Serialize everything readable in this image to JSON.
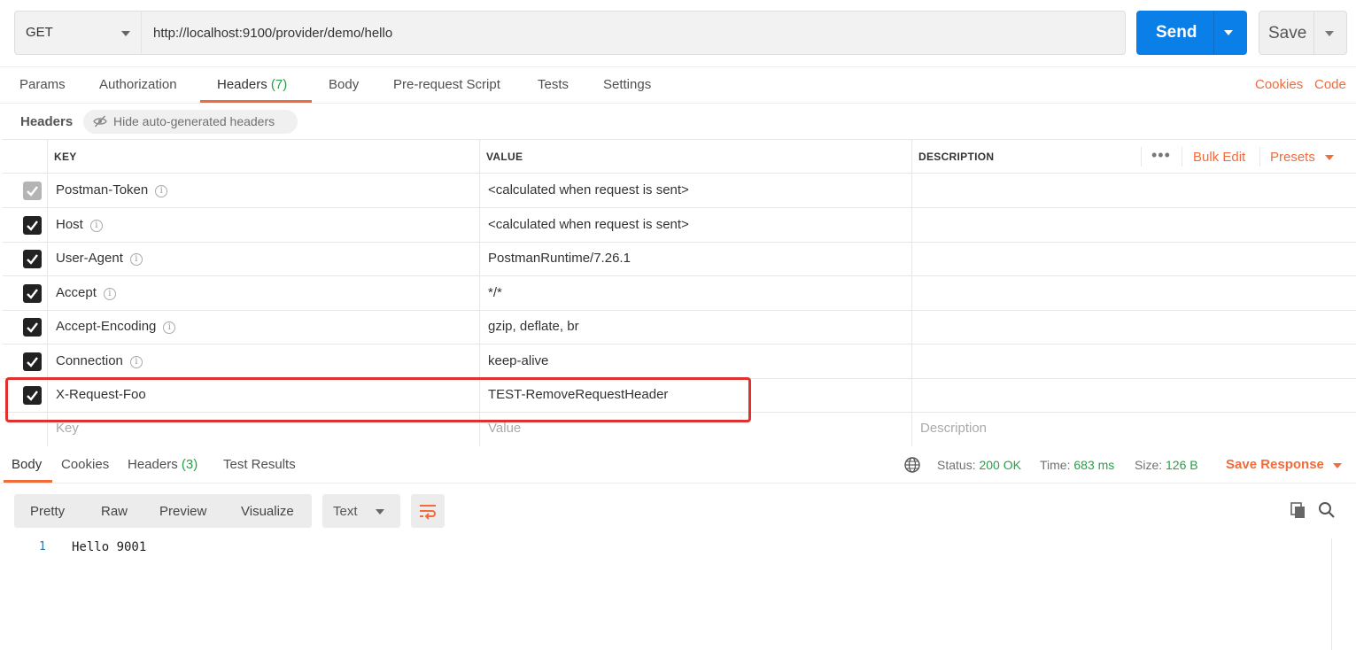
{
  "request": {
    "method": "GET",
    "url": "http://localhost:9100/provider/demo/hello",
    "send_label": "Send",
    "save_label": "Save"
  },
  "request_tabs": {
    "params": "Params",
    "authorization": "Authorization",
    "headers": "Headers",
    "headers_count": "(7)",
    "body": "Body",
    "pre_request": "Pre-request Script",
    "tests": "Tests",
    "settings": "Settings",
    "cookies": "Cookies",
    "code": "Code"
  },
  "headers_toolbar": {
    "title": "Headers",
    "hide_label": "Hide auto-generated headers"
  },
  "table": {
    "columns": {
      "key": "KEY",
      "value": "VALUE",
      "description": "DESCRIPTION"
    },
    "more": "•••",
    "bulk_edit": "Bulk Edit",
    "presets": "Presets",
    "rows": [
      {
        "key": "Postman-Token",
        "value": "<calculated when request is sent>",
        "checked": true,
        "disabled": true
      },
      {
        "key": "Host",
        "value": "<calculated when request is sent>",
        "checked": true
      },
      {
        "key": "User-Agent",
        "value": "PostmanRuntime/7.26.1",
        "checked": true
      },
      {
        "key": "Accept",
        "value": "*/*",
        "checked": true
      },
      {
        "key": "Accept-Encoding",
        "value": "gzip, deflate, br",
        "checked": true
      },
      {
        "key": "Connection",
        "value": "keep-alive",
        "checked": true
      },
      {
        "key": "X-Request-Foo",
        "value": "TEST-RemoveRequestHeader",
        "checked": true
      }
    ],
    "placeholders": {
      "key": "Key",
      "value": "Value",
      "description": "Description"
    },
    "info_glyph": "i"
  },
  "response_tabs": {
    "body": "Body",
    "cookies": "Cookies",
    "headers": "Headers",
    "headers_count": "(3)",
    "test_results": "Test Results"
  },
  "status": {
    "status_label": "Status:",
    "status_value": "200 OK",
    "time_label": "Time:",
    "time_value": "683 ms",
    "size_label": "Size:",
    "size_value": "126 B",
    "save_response": "Save Response"
  },
  "view_modes": [
    "Pretty",
    "Raw",
    "Preview",
    "Visualize"
  ],
  "format": "Text",
  "response_body": {
    "lines": [
      {
        "number": "1",
        "text": "Hello 9001"
      }
    ]
  },
  "colors": {
    "accent": "#f26b3a",
    "send": "#0b7fe8",
    "success": "#26a047",
    "highlight": "#e03131"
  },
  "icons": [
    "eye-off-icon",
    "info-icon",
    "checkbox-icon",
    "globe-icon",
    "wrap-icon",
    "copy-icon",
    "search-icon",
    "chevron-down-icon",
    "more-icon"
  ]
}
